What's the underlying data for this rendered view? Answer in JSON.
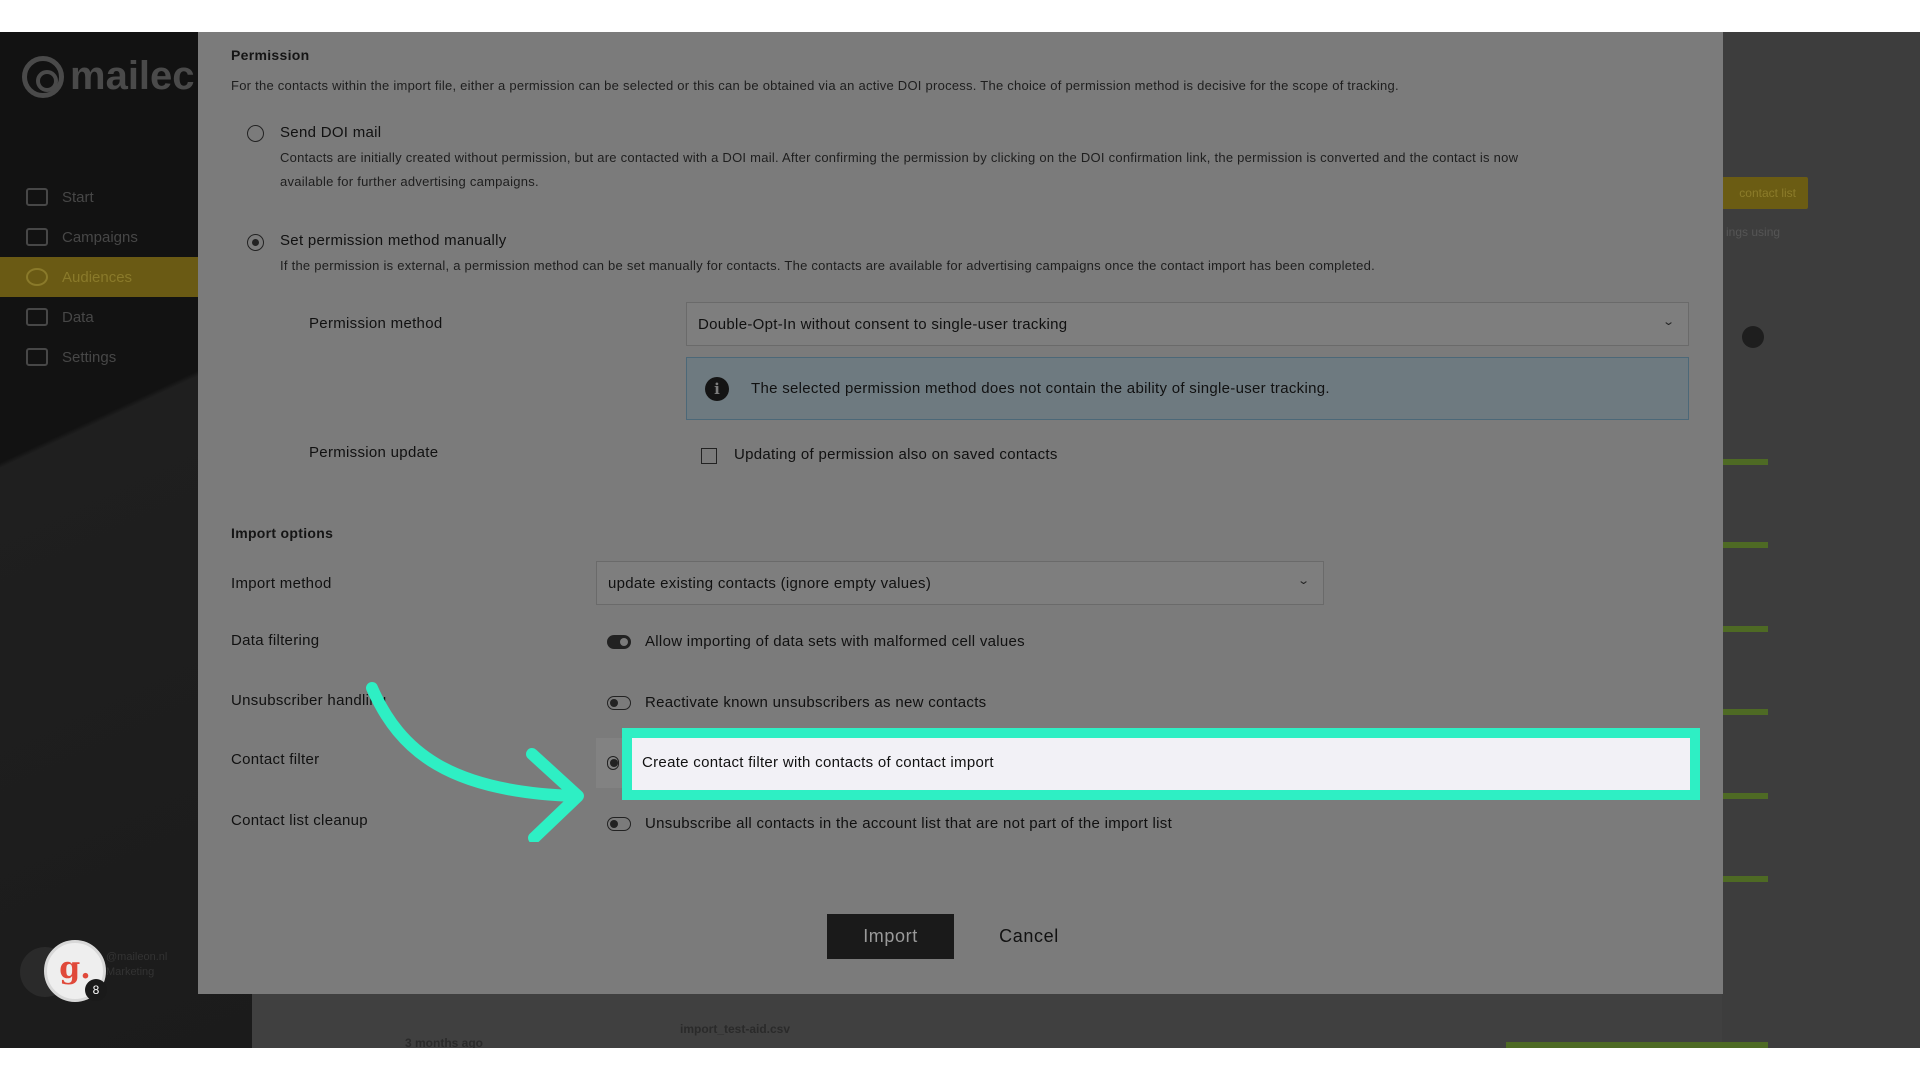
{
  "app": {
    "logo_text": "mailec"
  },
  "nav": {
    "items": [
      {
        "label": "Start"
      },
      {
        "label": "Campaigns"
      },
      {
        "label": "Audiences"
      },
      {
        "label": "Data"
      },
      {
        "label": "Settings"
      }
    ]
  },
  "background": {
    "right_button": "contact list",
    "right_text": "ings using",
    "bottom_left": "3 months ago",
    "bottom_file": "import_test-aid.csv"
  },
  "user": {
    "avatar_letter": "g.",
    "badge_count": "8",
    "line1": "@maileon.nl",
    "line2": "Marketing"
  },
  "permission": {
    "title": "Permission",
    "description": "For the contacts within the import file, either a permission can be selected or this can be obtained via an active DOI process. The choice of permission method is decisive for the scope of tracking.",
    "doi": {
      "label": "Send DOI mail",
      "description_line1": "Contacts are initially created without permission, but are contacted with a DOI mail. After confirming the permission by clicking on the DOI confirmation link, the permission is converted and the contact is now",
      "description_line2": "available for further advertising campaigns.",
      "selected": false
    },
    "manual": {
      "label": "Set permission method manually",
      "description": "If the permission is external, a permission method can be set manually for contacts. The contacts are available for advertising campaigns once the contact import has been completed.",
      "selected": true
    },
    "method_label": "Permission method",
    "method_value": "Double-Opt-In without consent to single-user tracking",
    "info": "The selected permission method does not contain the ability of single-user tracking.",
    "update_label": "Permission update",
    "update_checkbox": "Updating of permission also on saved contacts"
  },
  "import_options": {
    "title": "Import options",
    "method_label": "Import method",
    "method_value": "update existing contacts (ignore empty values)",
    "data_filtering_label": "Data filtering",
    "data_filtering_option": "Allow importing of data sets with malformed cell values",
    "unsubscriber_label": "Unsubscriber handling",
    "unsubscriber_option": "Reactivate known unsubscribers as new contacts",
    "contact_filter_label": "Contact filter",
    "contact_filter_option": "Create contact filter with contacts of contact import",
    "cleanup_label": "Contact list cleanup",
    "cleanup_option": "Unsubscribe all contacts in the account list that are not part of the import list"
  },
  "actions": {
    "import": "Import",
    "cancel": "Cancel"
  },
  "colors": {
    "highlight": "#2eefc4",
    "overlay": "#7b7b7b"
  }
}
